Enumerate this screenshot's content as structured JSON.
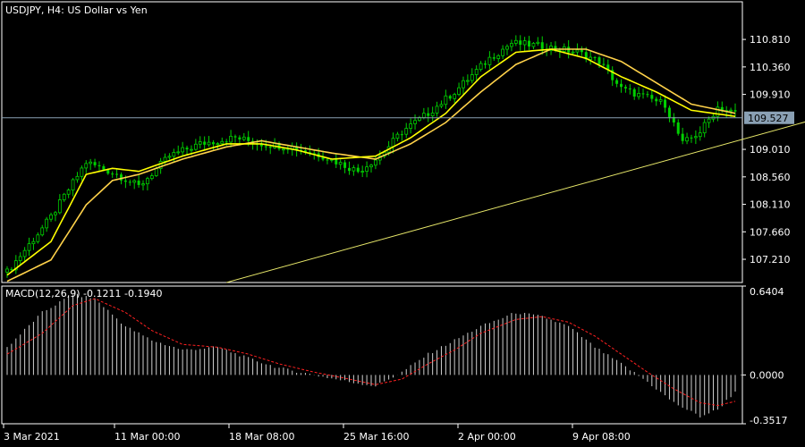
{
  "chart_data": [
    {
      "type": "candlestick",
      "title": "USDJPY, H4:  US Dollar vs Yen",
      "colors": {
        "bull": "#00d000",
        "bear": "#00d000",
        "ma_fast": "#ffff00",
        "ma_slow": "#ffd24a",
        "trendline": "#e8e86a",
        "price_line": "#8aa0b4",
        "price_label_bg": "#8aa0b4",
        "price_label_text": "#000000"
      },
      "ylim": [
        106.83,
        111.28
      ],
      "y_ticks": [
        "110.810",
        "110.360",
        "109.910",
        "109.010",
        "108.560",
        "108.110",
        "107.660",
        "107.210"
      ],
      "current_price": "109.527",
      "x_ticks": [
        "3 Mar 2021",
        "11 Mar 00:00",
        "18 Mar 08:00",
        "25 Mar 16:00",
        "2 Apr 00:00",
        "9 Apr 08:00"
      ],
      "closes_key": [
        [
          0,
          107.0
        ],
        [
          10,
          107.9
        ],
        [
          18,
          108.8
        ],
        [
          25,
          108.6
        ],
        [
          30,
          108.4
        ],
        [
          37,
          108.9
        ],
        [
          44,
          109.1
        ],
        [
          52,
          109.2
        ],
        [
          58,
          109.1
        ],
        [
          65,
          109.05
        ],
        [
          72,
          108.9
        ],
        [
          80,
          108.65
        ],
        [
          85,
          108.9
        ],
        [
          90,
          109.3
        ],
        [
          96,
          109.6
        ],
        [
          102,
          109.95
        ],
        [
          110,
          110.5
        ],
        [
          115,
          110.75
        ],
        [
          122,
          110.7
        ],
        [
          130,
          110.6
        ],
        [
          135,
          110.45
        ],
        [
          140,
          110.0
        ],
        [
          146,
          109.85
        ],
        [
          150,
          109.75
        ],
        [
          154,
          109.1
        ],
        [
          158,
          109.3
        ],
        [
          162,
          109.7
        ],
        [
          166,
          109.6
        ]
      ],
      "ma_fast_key": [
        [
          0,
          106.95
        ],
        [
          10,
          107.5
        ],
        [
          18,
          108.6
        ],
        [
          24,
          108.7
        ],
        [
          30,
          108.65
        ],
        [
          40,
          108.9
        ],
        [
          50,
          109.1
        ],
        [
          58,
          109.1
        ],
        [
          66,
          109.0
        ],
        [
          74,
          108.85
        ],
        [
          84,
          108.9
        ],
        [
          92,
          109.2
        ],
        [
          100,
          109.6
        ],
        [
          108,
          110.2
        ],
        [
          116,
          110.6
        ],
        [
          124,
          110.65
        ],
        [
          132,
          110.5
        ],
        [
          140,
          110.2
        ],
        [
          148,
          109.95
        ],
        [
          156,
          109.65
        ],
        [
          166,
          109.55
        ]
      ],
      "ma_slow_key": [
        [
          0,
          106.85
        ],
        [
          10,
          107.2
        ],
        [
          18,
          108.1
        ],
        [
          24,
          108.5
        ],
        [
          30,
          108.6
        ],
        [
          40,
          108.85
        ],
        [
          50,
          109.05
        ],
        [
          58,
          109.15
        ],
        [
          66,
          109.05
        ],
        [
          74,
          108.95
        ],
        [
          84,
          108.85
        ],
        [
          92,
          109.1
        ],
        [
          100,
          109.45
        ],
        [
          108,
          109.95
        ],
        [
          116,
          110.4
        ],
        [
          124,
          110.65
        ],
        [
          132,
          110.65
        ],
        [
          140,
          110.45
        ],
        [
          148,
          110.1
        ],
        [
          156,
          109.75
        ],
        [
          166,
          109.6
        ]
      ],
      "trendline": [
        [
          50,
          106.83
        ],
        [
          185,
          109.52
        ]
      ]
    },
    {
      "type": "bar",
      "title": "MACD(12,26,9) -0.1211 -0.1940",
      "ylim": [
        -0.3517,
        0.6404
      ],
      "y_ticks": [
        "0.6404",
        "0.0000",
        "-0.3517"
      ],
      "histogram_key": [
        [
          0,
          0.2
        ],
        [
          8,
          0.45
        ],
        [
          15,
          0.58
        ],
        [
          20,
          0.55
        ],
        [
          27,
          0.35
        ],
        [
          33,
          0.25
        ],
        [
          40,
          0.18
        ],
        [
          48,
          0.2
        ],
        [
          55,
          0.12
        ],
        [
          62,
          0.05
        ],
        [
          70,
          0.0
        ],
        [
          78,
          -0.05
        ],
        [
          84,
          -0.08
        ],
        [
          90,
          0.02
        ],
        [
          96,
          0.15
        ],
        [
          102,
          0.25
        ],
        [
          108,
          0.35
        ],
        [
          116,
          0.45
        ],
        [
          122,
          0.42
        ],
        [
          128,
          0.35
        ],
        [
          134,
          0.2
        ],
        [
          140,
          0.08
        ],
        [
          146,
          -0.05
        ],
        [
          152,
          -0.2
        ],
        [
          158,
          -0.3
        ],
        [
          162,
          -0.25
        ],
        [
          166,
          -0.12
        ]
      ],
      "signal_key": [
        [
          0,
          0.15
        ],
        [
          8,
          0.3
        ],
        [
          15,
          0.5
        ],
        [
          20,
          0.55
        ],
        [
          27,
          0.45
        ],
        [
          33,
          0.32
        ],
        [
          40,
          0.22
        ],
        [
          48,
          0.2
        ],
        [
          55,
          0.15
        ],
        [
          62,
          0.08
        ],
        [
          70,
          0.02
        ],
        [
          78,
          -0.03
        ],
        [
          84,
          -0.07
        ],
        [
          90,
          -0.03
        ],
        [
          96,
          0.08
        ],
        [
          102,
          0.18
        ],
        [
          108,
          0.3
        ],
        [
          116,
          0.4
        ],
        [
          122,
          0.42
        ],
        [
          128,
          0.38
        ],
        [
          134,
          0.28
        ],
        [
          140,
          0.15
        ],
        [
          146,
          0.02
        ],
        [
          152,
          -0.1
        ],
        [
          158,
          -0.2
        ],
        [
          162,
          -0.22
        ],
        [
          166,
          -0.19
        ]
      ]
    }
  ]
}
